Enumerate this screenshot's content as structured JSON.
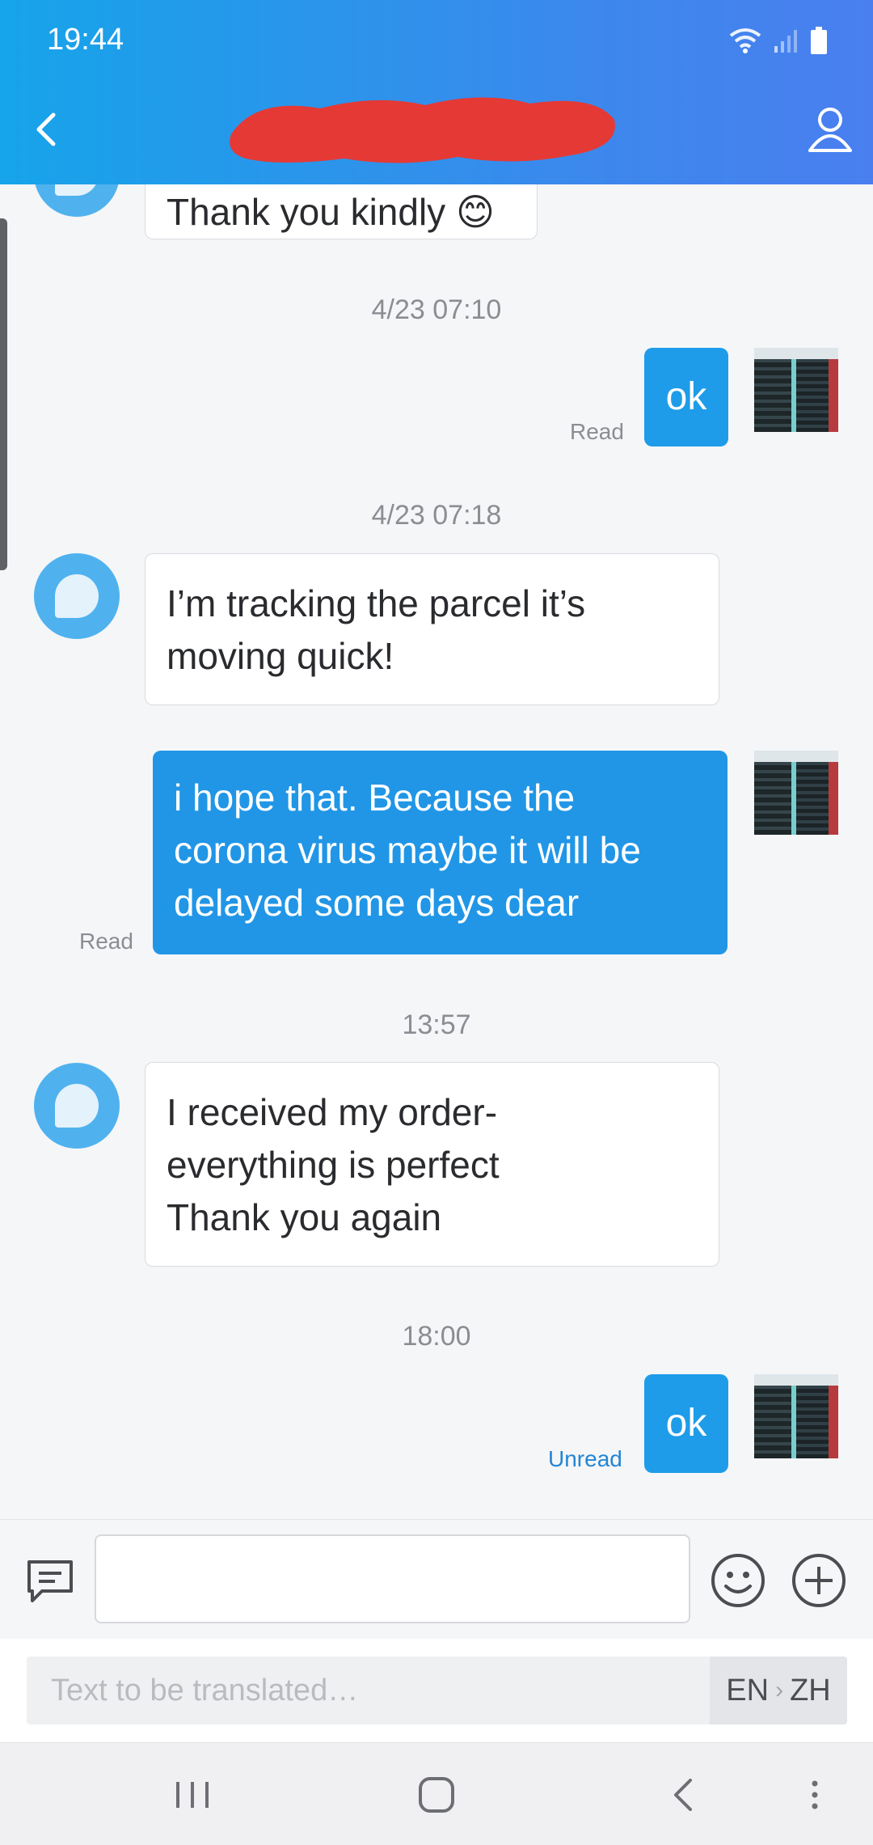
{
  "status": {
    "time": "19:44"
  },
  "header": {
    "back_icon": "chevron-left-icon",
    "profile_icon": "person-icon"
  },
  "messages": {
    "top_partial": {
      "text": "Thank you kindly 😊"
    },
    "ts1": "4/23 07:10",
    "out_ok_1": {
      "text": "ok",
      "status": "Read"
    },
    "ts2": "4/23 07:18",
    "in_tracking": {
      "lines": [
        "I’m tracking the parcel it’s",
        "moving quick!"
      ]
    },
    "out_hope": {
      "lines": [
        "i hope that. Because the",
        "corona virus maybe it will be",
        "delayed some days dear"
      ],
      "status": "Read"
    },
    "ts3": "13:57",
    "in_received": {
      "lines": [
        "I received my order-",
        "everything is perfect",
        "Thank you again"
      ]
    },
    "ts4": "18:00",
    "out_ok_2": {
      "text": "ok",
      "status": "Unread"
    }
  },
  "input": {
    "value": "",
    "placeholder": ""
  },
  "translate": {
    "placeholder": "Text to be translated…",
    "from": "EN",
    "to": "ZH"
  },
  "colors": {
    "header_start": "#16a4ea",
    "header_end": "#4a7ff0",
    "outgoing": "#2196e6",
    "unread": "#2385d4"
  }
}
